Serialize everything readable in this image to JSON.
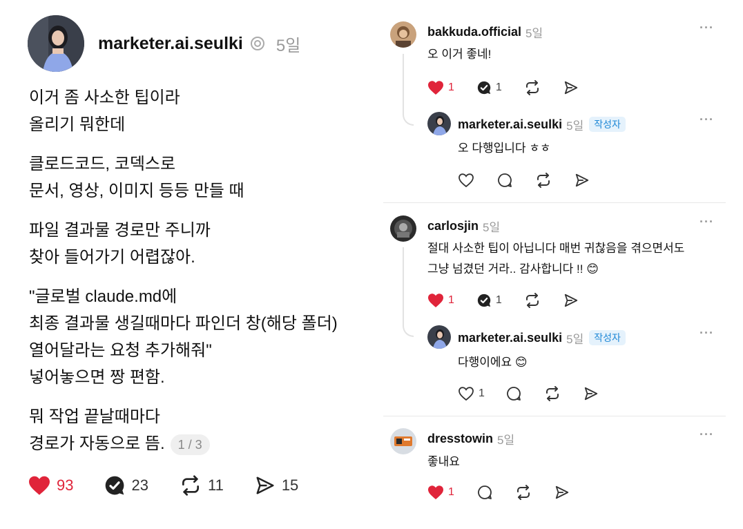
{
  "post": {
    "username": "marketer.ai.seulki",
    "time": "5일",
    "lines": [
      [
        "이거 좀 사소한 팁이라",
        "올리기 뭐한데"
      ],
      [
        "클로드코드, 코덱스로",
        "문서, 영상, 이미지 등등 만들 때"
      ],
      [
        "파일 결과물 경로만 주니까",
        "찾아 들어가기 어렵잖아."
      ],
      [
        "\"글로벌 claude.md에",
        "최종 결과물 생길때마다 파인더 창(해당 폴더)",
        "열어달라는 요청 추가해줘\"",
        "넣어놓으면 짱 편함."
      ],
      [
        "뭐 작업 끝날때마다",
        "경로가 자동으로 뜸."
      ]
    ],
    "pager": "1 / 3",
    "likes": "93",
    "replies": "23",
    "reposts": "11",
    "shares": "15"
  },
  "comments": [
    {
      "username": "bakkuda.official",
      "time": "5일",
      "text": "오 이거 좋네!",
      "likes": "1",
      "replies": "1",
      "reply": {
        "username": "marketer.ai.seulki",
        "time": "5일",
        "badge": "작성자",
        "text": "오 다행입니다 ㅎㅎ"
      }
    },
    {
      "username": "carlosjin",
      "time": "5일",
      "text_lines": [
        "절대 사소한 팁이 아닙니다 매번 귀찮음을 겪으면서도",
        "그냥 넘겼던 거라.. 감사합니다 !! 😊"
      ],
      "likes": "1",
      "replies": "1",
      "reply": {
        "username": "marketer.ai.seulki",
        "time": "5일",
        "badge": "작성자",
        "text": "다행이에요 😊",
        "likes": "1"
      }
    },
    {
      "username": "dresstowin",
      "time": "5일",
      "text": "좋내요",
      "likes": "1"
    }
  ],
  "more_label": "···",
  "colors": {
    "like_red": "#e0243a",
    "badge_blue": "#1f88d6",
    "badge_bg": "#e5f2fc",
    "muted": "#999999"
  }
}
